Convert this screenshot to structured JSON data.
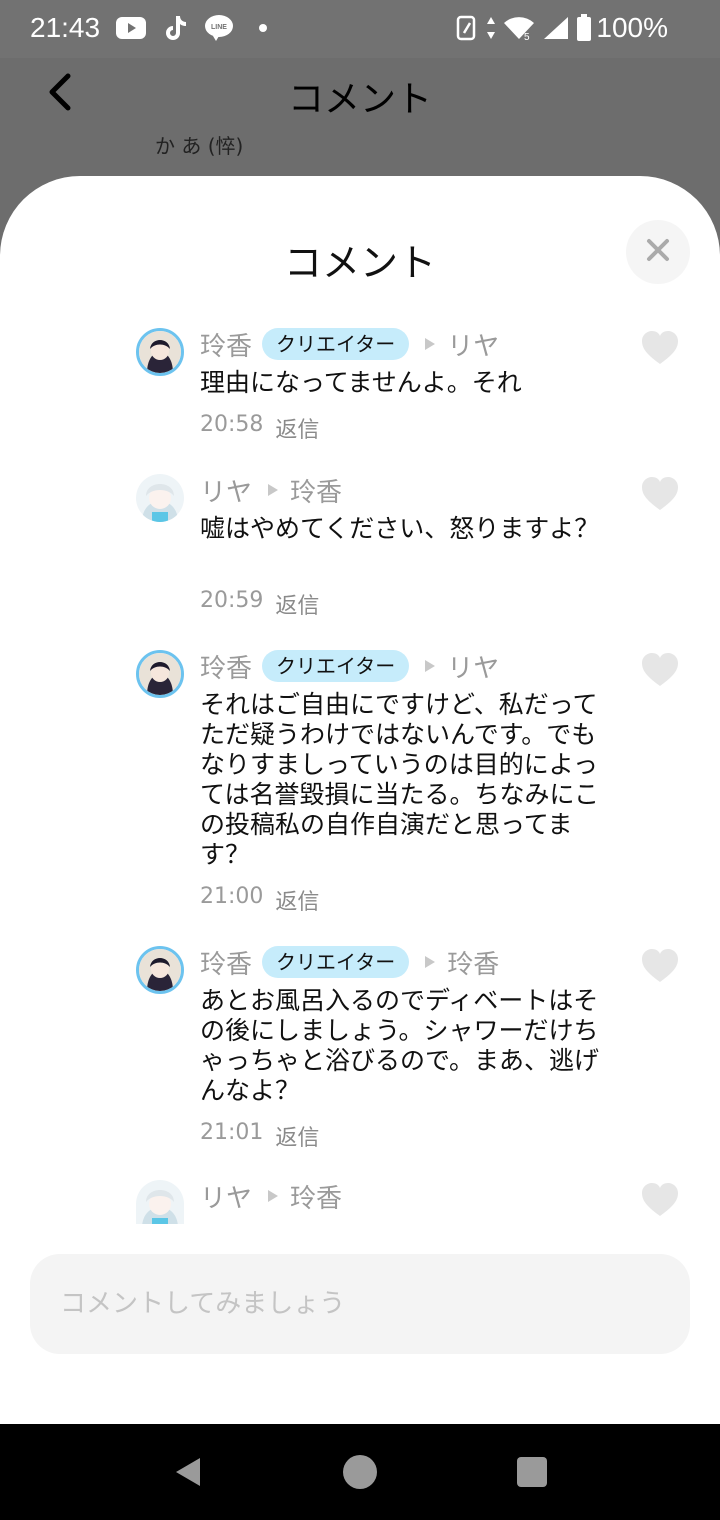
{
  "status_bar": {
    "time": "21:43",
    "apps": [
      "youtube-icon",
      "tiktok-icon",
      "line-icon"
    ],
    "battery": "100%"
  },
  "background_page": {
    "title": "コメント",
    "subtitle": "か あ (悴)"
  },
  "sheet": {
    "title": "コメント",
    "comments": [
      {
        "author": "玲香",
        "badge": "クリエイター",
        "reply_to": "リヤ",
        "text": "理由になってませんよ。それ",
        "time": "20:58",
        "reply_label": "返信"
      },
      {
        "author": "リヤ",
        "badge": "",
        "reply_to": "玲香",
        "text": "嘘はやめてください、怒りますよ？",
        "time": "20:59",
        "reply_label": "返信"
      },
      {
        "author": "玲香",
        "badge": "クリエイター",
        "reply_to": "リヤ",
        "text": "それはご自由にですけど、私だってただ疑うわけではないんです。でもなりすましっていうのは目的によっては名誉毀損に当たる。ちなみにこの投稿私の自作自演だと思ってます？",
        "time": "21:00",
        "reply_label": "返信"
      },
      {
        "author": "玲香",
        "badge": "クリエイター",
        "reply_to": "玲香",
        "text": "あとお風呂入るのでディベートはその後にしましょう。シャワーだけちゃっちゃと浴びるので。まあ、逃げんなよ？",
        "time": "21:01",
        "reply_label": "返信"
      },
      {
        "author": "リヤ",
        "badge": "",
        "reply_to": "玲香",
        "text": "",
        "time": "",
        "reply_label": ""
      }
    ],
    "input_placeholder": "コメントしてみましょう"
  },
  "colors": {
    "badge_bg": "#c6ecfb",
    "creator_ring": "#6cc3ef",
    "dim_overlay": "#6d6d6d"
  }
}
